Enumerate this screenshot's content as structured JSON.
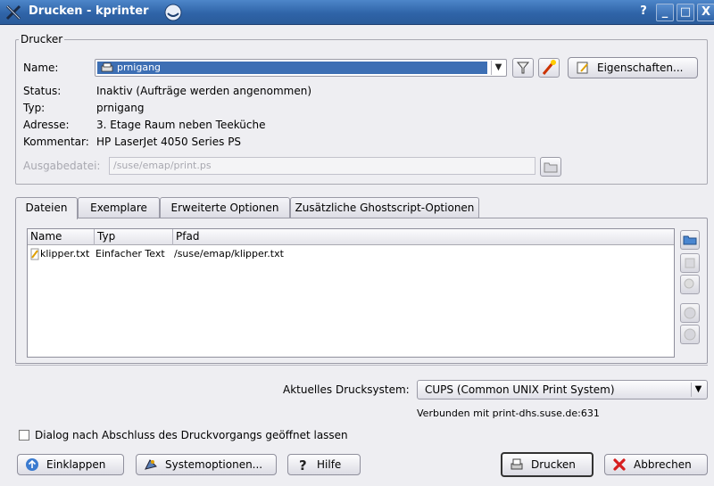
{
  "window": {
    "title": "Drucken - kprinter",
    "buttons": {
      "help": "?",
      "minimize": "_",
      "maximize": "□",
      "close": "X"
    }
  },
  "printer_group": {
    "legend": "Drucker",
    "name_label": "Name:",
    "name_value": "prnigang",
    "status_label": "Status:",
    "status_value": "Inaktiv (Aufträge werden angenommen)",
    "type_label": "Typ:",
    "type_value": "prnigang",
    "address_label": "Adresse:",
    "address_value": "3. Etage Raum neben Teeküche",
    "comment_label": "Kommentar:",
    "comment_value": "HP LaserJet 4050 Series PS",
    "output_file_label": "Ausgabedatei:",
    "output_file_value": "/suse/emap/print.ps",
    "properties_button": "Eigenschaften..."
  },
  "tabs": [
    {
      "label": "Dateien"
    },
    {
      "label": "Exemplare"
    },
    {
      "label": "Erweiterte Optionen"
    },
    {
      "label": "Zusätzliche Ghostscript-Optionen"
    }
  ],
  "file_list": {
    "columns": [
      "Name",
      "Typ",
      "Pfad"
    ],
    "rows": [
      {
        "name": "klipper.txt",
        "type": "Einfacher Text",
        "path": "/suse/emap/klipper.txt"
      }
    ]
  },
  "print_system": {
    "label": "Aktuelles Drucksystem:",
    "value": "CUPS (Common UNIX Print System)",
    "connection": "Verbunden mit print-dhs.suse.de:631"
  },
  "keep_dialog_open": {
    "label": "Dialog nach Abschluss des Druckvorgangs geöffnet lassen",
    "checked": false
  },
  "footer_buttons": {
    "collapse": "Einklappen",
    "system_options": "Systemoptionen...",
    "help": "Hilfe",
    "print": "Drucken",
    "cancel": "Abbrechen"
  }
}
